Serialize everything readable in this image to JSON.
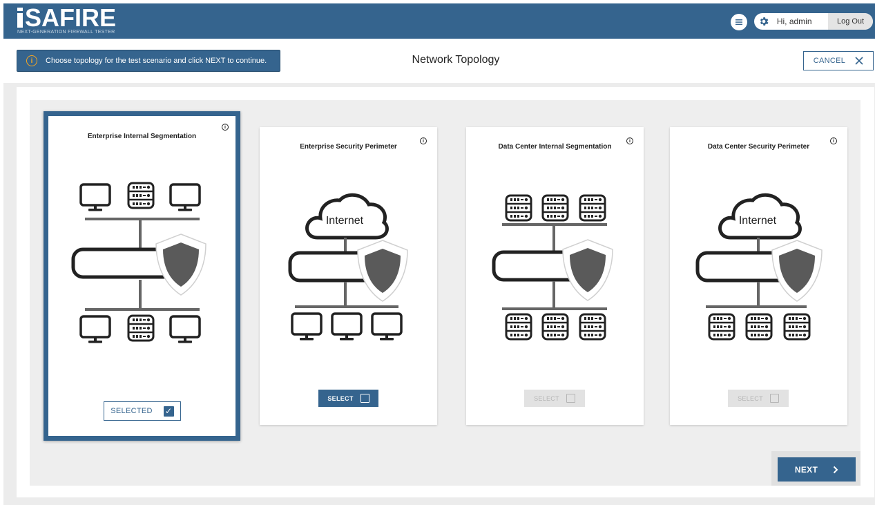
{
  "header": {
    "logo": "SAFIRE",
    "logo_tagline": "NEXT-GENERATION FIREWALL TESTER",
    "greeting": "Hi, admin",
    "logout_label": "Log Out"
  },
  "topbar": {
    "info_text": "Choose topology for the test scenario and click NEXT to continue.",
    "page_title": "Network Topology",
    "cancel_label": "CANCEL"
  },
  "cards": [
    {
      "title": "Enterprise Internal Segmentation",
      "button": "SELECTED",
      "state": "selected"
    },
    {
      "title": "Enterprise Security Perimeter",
      "button": "SELECT",
      "state": "active",
      "cloud_label": "Internet"
    },
    {
      "title": "Data Center Internal Segmentation",
      "button": "SELECT",
      "state": "disabled"
    },
    {
      "title": "Data Center Security Perimeter",
      "button": "SELECT",
      "state": "disabled",
      "cloud_label": "Internet"
    }
  ],
  "footer": {
    "next_label": "NEXT"
  },
  "colors": {
    "brand": "#35648e",
    "alert_icon": "#f5a623",
    "shield": "#5a5a5a"
  },
  "icons": [
    "menu-icon",
    "gear-icon",
    "info-icon",
    "close-icon",
    "checkbox-icon",
    "chevron-right-icon",
    "monitor-icon",
    "server-icon",
    "shield-icon",
    "cloud-icon"
  ]
}
